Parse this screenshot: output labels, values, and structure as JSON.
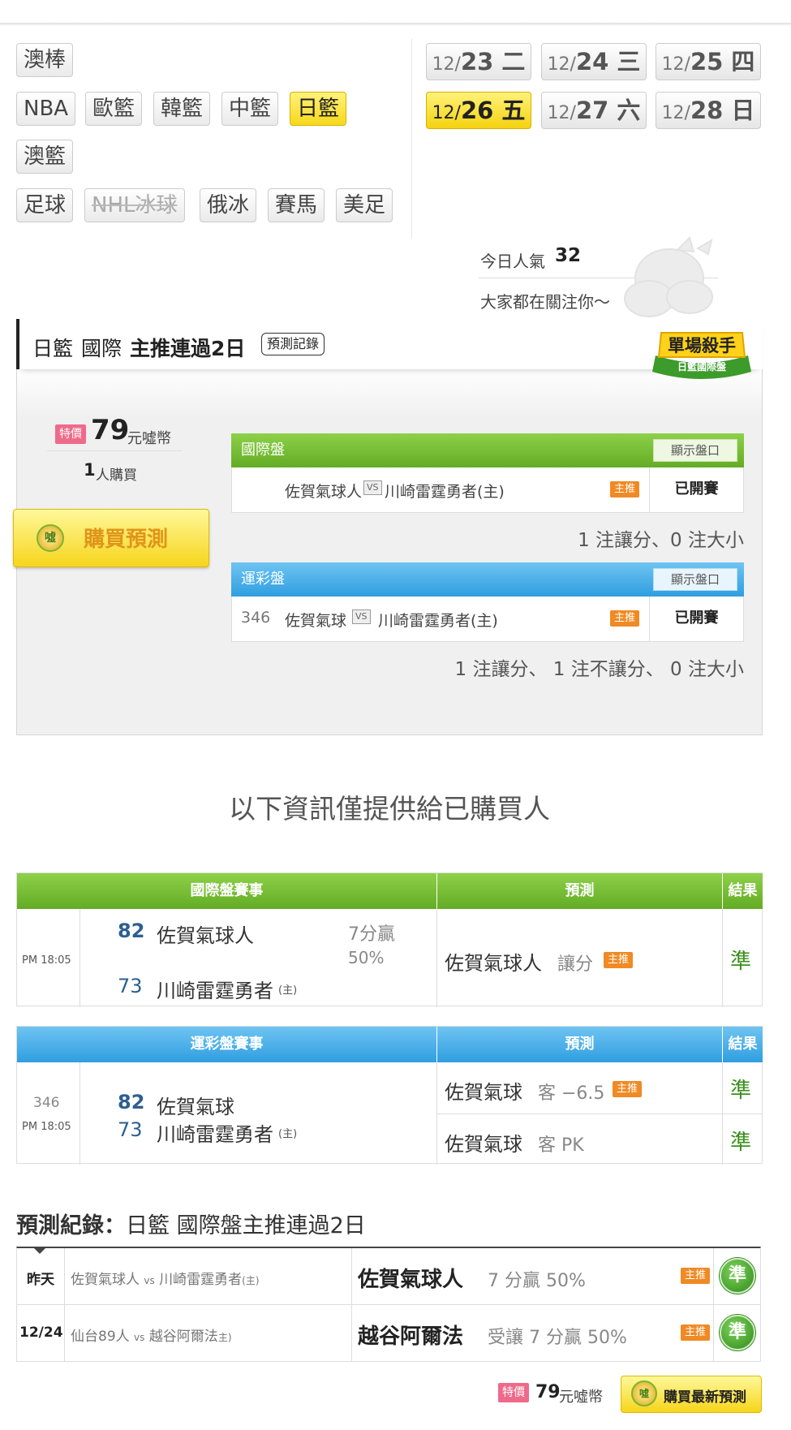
{
  "sports": {
    "row1": [
      "澳棒"
    ],
    "row2": [
      "NBA",
      "歐籃",
      "韓籃",
      "中籃",
      "日籃"
    ],
    "row3": [
      "澳籃"
    ],
    "row4": [
      "足球",
      "NHL冰球",
      "俄冰",
      "賽馬",
      "美足"
    ]
  },
  "dates": [
    {
      "m": "12/",
      "d": "23 二"
    },
    {
      "m": "12/",
      "d": "24 三"
    },
    {
      "m": "12/",
      "d": "25 四"
    },
    {
      "m": "12/",
      "d": "26 五"
    },
    {
      "m": "12/",
      "d": "27 六"
    },
    {
      "m": "12/",
      "d": "28 日"
    }
  ],
  "popularity": {
    "label": "今日人氣",
    "value": "32",
    "tagline": "大家都在關注你～"
  },
  "panel": {
    "league": "日籃",
    "type": "國際",
    "streak": "主推連過2日",
    "record_btn": "預測記錄",
    "badge_top": "單場殺手",
    "badge_bottom": "日籃國際盤",
    "price_tag": "特價",
    "price": "79",
    "price_unit": "元噓幣",
    "buyers_n": "1",
    "buyers_label": "人購買",
    "buy_btn": "購買預測",
    "coin": "噓",
    "intl": {
      "title": "國際盤",
      "show": "顯示盤口",
      "away": "佐賀氣球人",
      "vs": "VS",
      "home": "川崎雷霆勇者(主)",
      "tag": "主推",
      "status": "已開賽",
      "summary": "1 注讓分、0 注大小"
    },
    "lottery": {
      "title": "運彩盤",
      "show": "顯示盤口",
      "code": "346",
      "away": "佐賀氣球",
      "vs": "VS",
      "home": "川崎雷霆勇者(主)",
      "tag": "主推",
      "status": "已開賽",
      "summary": "1 注讓分、 1 注不讓分、 0 注大小"
    }
  },
  "notice": "以下資訊僅提供給已購買人",
  "intl_table": {
    "h1": "國際盤賽事",
    "h2": "預測",
    "h3": "結果",
    "time": "PM 18:05",
    "s1": "82",
    "t1": "佐賀氣球人",
    "s2": "73",
    "t2": "川崎雷霆勇者",
    "home": "(主)",
    "margin": "7分贏",
    "pct": "50%",
    "pick": "佐賀氣球人",
    "pick_type": "讓分",
    "tag": "主推",
    "result": "準"
  },
  "lottery_table": {
    "h1": "運彩盤賽事",
    "h2": "預測",
    "h3": "結果",
    "code": "346",
    "time": "PM 18:05",
    "s1": "82",
    "t1": "佐賀氣球",
    "s2": "73",
    "t2": "川崎雷霆勇者",
    "home": "(主)",
    "p1": "佐賀氣球",
    "p1_side": "客 −6.5",
    "tag": "主推",
    "r1": "準",
    "p2": "佐賀氣球",
    "p2_side": "客 PK",
    "r2": "準"
  },
  "record": {
    "title_bold": "預測紀錄：",
    "title_rest": "日籃 國際盤主推連過2日",
    "rows": [
      {
        "day": "昨天",
        "away": "佐賀氣球人",
        "vs": "vs",
        "home": "川崎雷霆勇者",
        "home_tag": "(主)",
        "pick": "佐賀氣球人",
        "detail": "7 分贏 50%",
        "tag": "主推",
        "result": "準"
      },
      {
        "day": "12/24",
        "away": "仙台89人",
        "vs": "vs",
        "home": "越谷阿爾法",
        "home_tag": "主)",
        "pick": "越谷阿爾法",
        "detail": "受讓 7 分贏 50%",
        "tag": "主推",
        "result": "準"
      }
    ]
  },
  "footer": {
    "price_tag": "特價",
    "price": "79",
    "unit": "元噓幣",
    "buy_latest": "購買最新預測",
    "coin": "噓"
  },
  "colors": {
    "green": "#63ac24",
    "blue": "#2f9ee0",
    "yellow": "#f7d81b",
    "tag_orange": "#f08a24",
    "ok_green": "#3a8f1b"
  }
}
